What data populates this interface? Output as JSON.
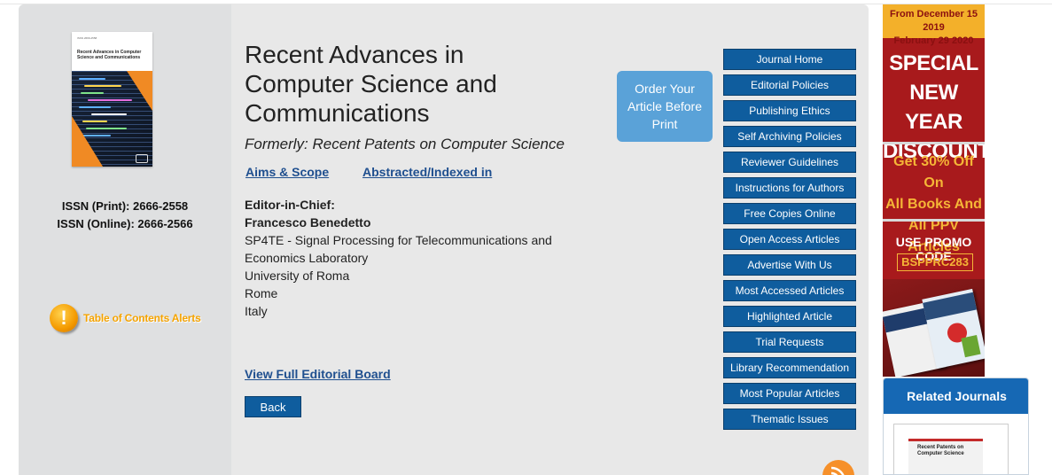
{
  "journal": {
    "title": "Recent Advances in Computer Science and Communications",
    "formerly": "Formerly: Recent Patents on Computer Science",
    "cover": {
      "top_line": "ISSN 2666-2558",
      "title": "Recent Advances in Computer Science and Communications"
    },
    "issn_print": "ISSN (Print): 2666-2558",
    "issn_online": "ISSN (Online): 2666-2566"
  },
  "toc_alerts": {
    "label": "Table of Contents Alerts",
    "icon": "exclamation-icon"
  },
  "links": {
    "aims_scope": "Aims & Scope",
    "abstracted": "Abstracted/Indexed in"
  },
  "editor": {
    "heading": "Editor-in-Chief:",
    "name": "Francesco Benedetto",
    "affiliation_line1": "SP4TE - Signal Processing for Telecommunications and",
    "affiliation_line2": "Economics Laboratory",
    "university": "University of Roma",
    "city": "Rome",
    "country": "Italy"
  },
  "view_board": "View Full Editorial Board",
  "back": "Back",
  "order_button": "Order Your Article Before Print",
  "nav": [
    "Journal Home",
    "Editorial Policies",
    "Publishing Ethics",
    "Self Archiving Policies",
    "Reviewer Guidelines",
    "Instructions for Authors",
    "Free Copies Online",
    "Open Access Articles",
    "Advertise With Us",
    "Most Accessed Articles",
    "Highlighted Article",
    "Trial Requests",
    "Library Recommendation",
    "Most Popular Articles",
    "Thematic Issues"
  ],
  "ad": {
    "dates_line1": "From December 15 2019",
    "dates_line2": "February 29 2020",
    "special1": "SPECIAL",
    "special2": "NEW YEAR",
    "special3": "DISCOUNT!",
    "get1": "Get 30% Off On",
    "get2": "All Books And",
    "get3": "All PPV Articles",
    "promo_label": "USE PROMO CODE",
    "promo_code": "BSPPRC283"
  },
  "related": {
    "heading": "Related Journals",
    "book_title": "Recent Patents on Computer Science"
  },
  "colors": {
    "nav_button": "#0f5d9e",
    "link": "#1f4f8f",
    "order_button": "#5aa2d8",
    "ad_red": "#a81a1c",
    "ad_gold": "#f3b02a",
    "related_header": "#1668b4",
    "rss": "#f6902a"
  }
}
